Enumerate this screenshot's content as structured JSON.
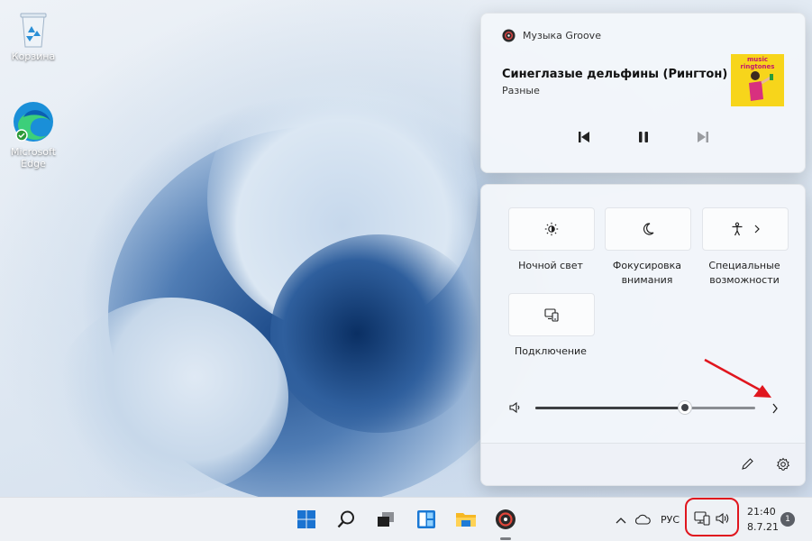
{
  "desktop": {
    "icons": [
      {
        "label": "Корзина",
        "icon": "recycle-bin-icon"
      },
      {
        "label": "Microsoft Edge",
        "icon": "edge-icon"
      }
    ]
  },
  "media": {
    "app_name": "Музыка Groove",
    "track_title": "Синеглазые дельфины (Рингтон)",
    "artist": "Разные",
    "album_art_text": "music ringtones",
    "state": "playing",
    "controls": [
      "previous-icon",
      "pause-icon",
      "next-icon"
    ]
  },
  "quick_settings": {
    "tiles": [
      {
        "label": "Ночной свет",
        "icon": "brightness-icon"
      },
      {
        "label": "Фокусировка внимания",
        "icon": "moon-icon"
      },
      {
        "label": "Специальные возможности",
        "icon": "accessibility-icon",
        "has_chevron": true
      },
      {
        "label": "Подключение",
        "icon": "cast-icon"
      }
    ],
    "volume": 0.68,
    "footer_icons": [
      "edit-icon",
      "settings-icon"
    ]
  },
  "taskbar": {
    "apps": [
      "start-icon",
      "search-icon",
      "task-view-icon",
      "widgets-icon",
      "file-explorer-icon",
      "groove-music-icon"
    ],
    "language": "РУС",
    "time": "21:40",
    "date": "8.7.21",
    "notification_count": "1"
  },
  "colors": {
    "accent": "#0067c0",
    "highlight_frame": "#e0161e",
    "annotation_arrow": "#e0161e"
  }
}
